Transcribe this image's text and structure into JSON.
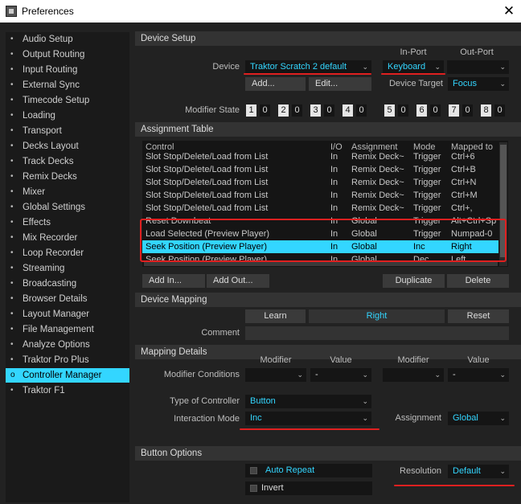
{
  "window": {
    "title": "Preferences",
    "close_glyph": "✕"
  },
  "sidebar": {
    "items": [
      {
        "label": "Audio Setup",
        "active": false
      },
      {
        "label": "Output Routing",
        "active": false
      },
      {
        "label": "Input Routing",
        "active": false
      },
      {
        "label": "External Sync",
        "active": false
      },
      {
        "label": "Timecode Setup",
        "active": false
      },
      {
        "label": "Loading",
        "active": false
      },
      {
        "label": "Transport",
        "active": false
      },
      {
        "label": "Decks Layout",
        "active": false
      },
      {
        "label": "Track Decks",
        "active": false
      },
      {
        "label": "Remix Decks",
        "active": false
      },
      {
        "label": "Mixer",
        "active": false
      },
      {
        "label": "Global Settings",
        "active": false
      },
      {
        "label": "Effects",
        "active": false
      },
      {
        "label": "Mix Recorder",
        "active": false
      },
      {
        "label": "Loop Recorder",
        "active": false
      },
      {
        "label": "Streaming",
        "active": false
      },
      {
        "label": "Broadcasting",
        "active": false
      },
      {
        "label": "Browser Details",
        "active": false
      },
      {
        "label": "Layout Manager",
        "active": false
      },
      {
        "label": "File Management",
        "active": false
      },
      {
        "label": "Analyze Options",
        "active": false
      },
      {
        "label": "Traktor Pro Plus",
        "active": false
      },
      {
        "label": "Controller Manager",
        "active": true
      },
      {
        "label": "Traktor F1",
        "active": false
      }
    ]
  },
  "device_setup": {
    "title": "Device Setup",
    "in_port_label": "In-Port",
    "out_port_label": "Out-Port",
    "device_label": "Device",
    "device_value": "Traktor Scratch 2 default",
    "in_port_value": "Keyboard",
    "out_port_value": "",
    "add_button": "Add...",
    "edit_button": "Edit...",
    "device_target_label": "Device Target",
    "device_target_value": "Focus",
    "modifier_state_label": "Modifier State",
    "modifier_state": [
      "1",
      "0",
      "2",
      "0",
      "3",
      "0",
      "4",
      "0",
      "5",
      "0",
      "6",
      "0",
      "7",
      "0",
      "8",
      "0"
    ]
  },
  "assignment_table": {
    "title": "Assignment Table",
    "columns": [
      "Control",
      "I/O",
      "Assignment",
      "Mode",
      "Mapped to"
    ],
    "rows": [
      {
        "control": "Slot Stop/Delete/Load from List",
        "io": "In",
        "assignment": "Remix Deck~",
        "mode": "Trigger",
        "mapped": "Ctrl+6"
      },
      {
        "control": "Slot Stop/Delete/Load from List",
        "io": "In",
        "assignment": "Remix Deck~",
        "mode": "Trigger",
        "mapped": "Ctrl+B"
      },
      {
        "control": "Slot Stop/Delete/Load from List",
        "io": "In",
        "assignment": "Remix Deck~",
        "mode": "Trigger",
        "mapped": "Ctrl+N"
      },
      {
        "control": "Slot Stop/Delete/Load from List",
        "io": "In",
        "assignment": "Remix Deck~",
        "mode": "Trigger",
        "mapped": "Ctrl+M"
      },
      {
        "control": "Slot Stop/Delete/Load from List",
        "io": "In",
        "assignment": "Remix Deck~",
        "mode": "Trigger",
        "mapped": "Ctrl+,"
      },
      {
        "control": "Reset Downbeat",
        "io": "In",
        "assignment": "Global",
        "mode": "Trigger",
        "mapped": "Alt+Ctrl+Sp"
      },
      {
        "control": "Load Selected (Preview Player)",
        "io": "In",
        "assignment": "Global",
        "mode": "Trigger",
        "mapped": "Numpad-0"
      },
      {
        "control": "Seek Position (Preview Player)",
        "io": "In",
        "assignment": "Global",
        "mode": "Inc",
        "mapped": "Right",
        "selected": true
      },
      {
        "control": "Seek Position (Preview Player)",
        "io": "In",
        "assignment": "Global",
        "mode": "Dec",
        "mapped": "Left"
      }
    ],
    "add_in_button": "Add In...",
    "add_out_button": "Add Out...",
    "duplicate_button": "Duplicate",
    "delete_button": "Delete"
  },
  "device_mapping": {
    "title": "Device Mapping",
    "learn_button": "Learn",
    "mapped_value": "Right",
    "reset_button": "Reset",
    "comment_label": "Comment",
    "comment_value": ""
  },
  "mapping_details": {
    "title": "Mapping Details",
    "modifier_header": "Modifier",
    "value_header": "Value",
    "modifier_conditions_label": "Modifier Conditions",
    "cond1_modifier": "",
    "cond1_value": "-",
    "cond2_modifier": "",
    "cond2_value": "-",
    "type_of_controller_label": "Type of Controller",
    "type_of_controller_value": "Button",
    "interaction_mode_label": "Interaction Mode",
    "interaction_mode_value": "Inc",
    "assignment_label": "Assignment",
    "assignment_value": "Global"
  },
  "button_options": {
    "title": "Button Options",
    "auto_repeat_label": "Auto Repeat",
    "invert_label": "Invert",
    "resolution_label": "Resolution",
    "resolution_value": "Default"
  },
  "colors": {
    "accent": "#33d6ff",
    "annotation": "#e02020",
    "panel": "#222222"
  }
}
